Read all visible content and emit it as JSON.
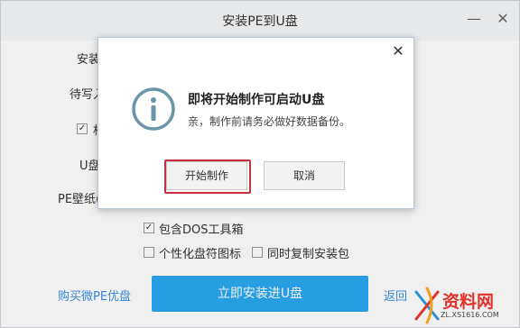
{
  "window": {
    "title": "安装PE到U盘",
    "minimize_glyph": "—",
    "close_glyph": "✕"
  },
  "form": {
    "label_install": "安装",
    "label_pending": "待写入",
    "label_checkbox_partial": "相",
    "label_udisk": "U盘",
    "label_wallpaper": "PE壁纸(",
    "dos_toolbox": "包含DOS工具箱",
    "custom_icon": "个性化盘符图标",
    "copy_installer": "同时复制安装包",
    "dos_checked": true,
    "custom_icon_checked": false,
    "copy_installer_checked": false,
    "partial_checked": true
  },
  "footer": {
    "buy_link": "购买微PE优盘",
    "install_button": "立即安装进U盘",
    "back_link": "返回"
  },
  "dialog": {
    "title": "即将开始制作可启动U盘",
    "message": "亲，制作前请务必做好数据备份。",
    "start_button": "开始制作",
    "cancel_button": "取消",
    "close_glyph": "✕",
    "icon": "info-icon",
    "highlight_color": "#c0333a"
  },
  "watermark": {
    "text": "资料网",
    "url": "ZL.XS1616.COM"
  }
}
